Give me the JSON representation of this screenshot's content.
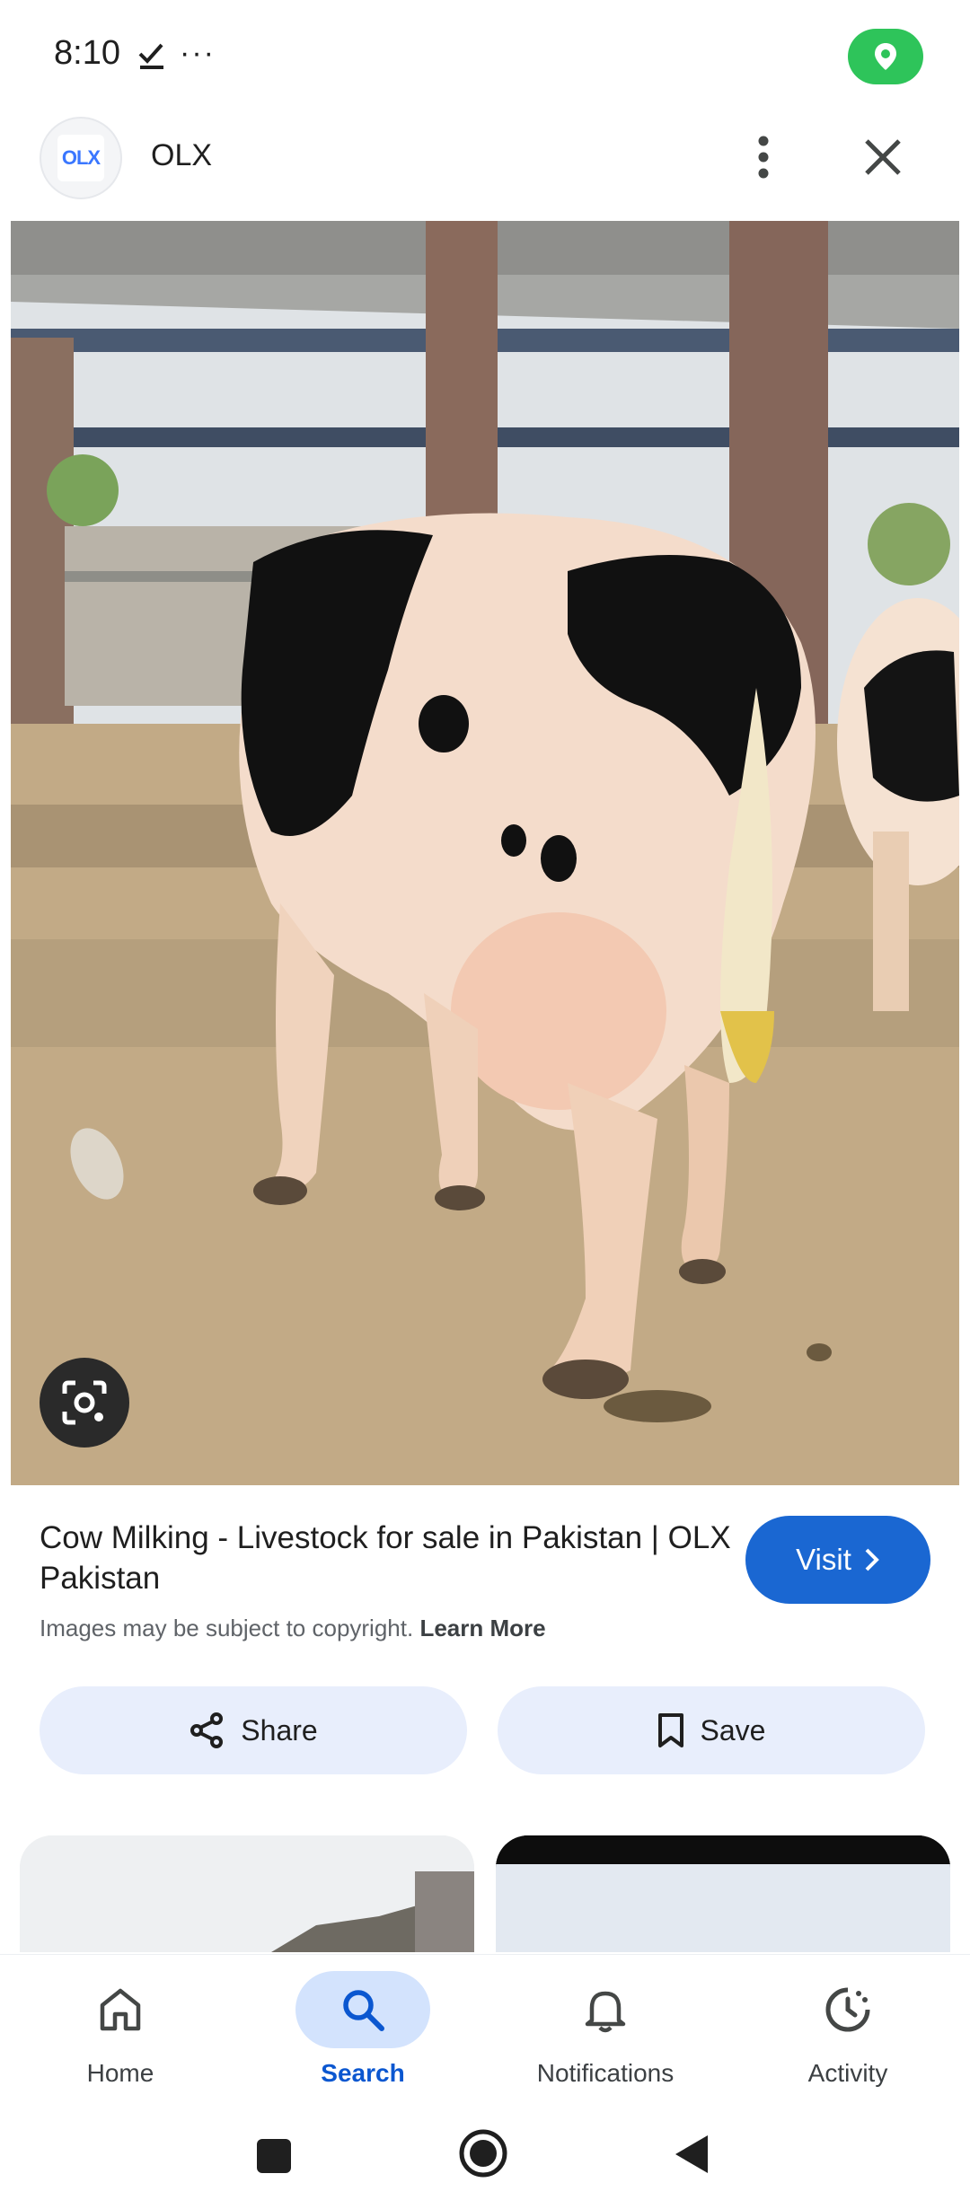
{
  "status_bar": {
    "time": "8:10",
    "check_icon": "check-icon",
    "more_dots": "···",
    "location_icon": "location-pin-icon",
    "location_pill_color": "#2ec45a"
  },
  "header": {
    "site_logo_text": "OLX",
    "site_name": "OLX",
    "more_icon": "vertical-dots-icon",
    "close_icon": "close-icon"
  },
  "result": {
    "title": "Cow Milking - Livestock for sale in Pakistan | OLX Pakistan",
    "visit_label": "Visit",
    "copyright_text": "Images may be subject to copyright.",
    "learn_more": "Learn More",
    "share_label": "Share",
    "save_label": "Save",
    "accent_color": "#1a67d2"
  },
  "bottom_nav": {
    "items": [
      {
        "label": "Home",
        "icon": "home-icon",
        "selected": false
      },
      {
        "label": "Search",
        "icon": "search-icon",
        "selected": true
      },
      {
        "label": "Notifications",
        "icon": "bell-icon",
        "selected": false
      },
      {
        "label": "Activity",
        "icon": "activity-icon",
        "selected": false
      }
    ]
  },
  "system_nav": {
    "recent_icon": "recent-apps-icon",
    "home_icon": "home-circle-icon",
    "back_icon": "back-triangle-icon"
  }
}
